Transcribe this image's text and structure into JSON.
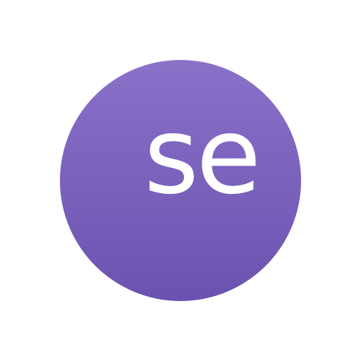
{
  "logo": {
    "text": "se",
    "colors": {
      "circle_top": "#8a72c9",
      "circle_bottom": "#6a52b0",
      "text": "#ffffff",
      "background": "#ffffff"
    }
  }
}
